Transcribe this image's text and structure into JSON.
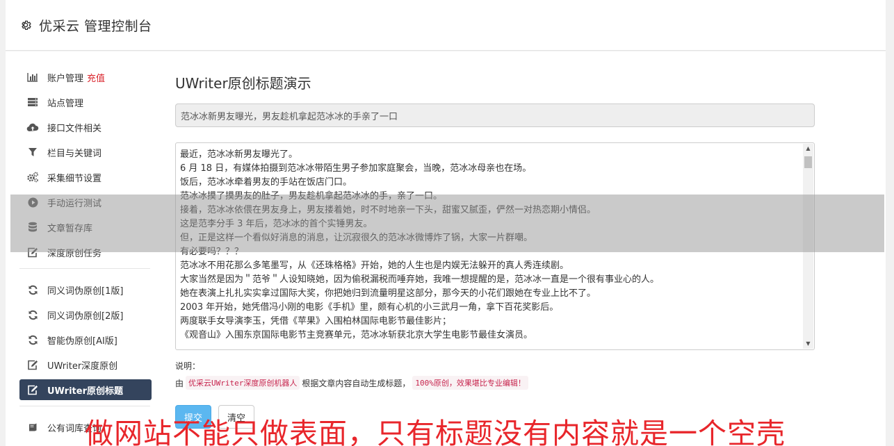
{
  "header": {
    "title": "优采云 管理控制台",
    "icon": "gear-icon"
  },
  "sidebar": {
    "items": [
      {
        "label": "账户管理",
        "accent": "充值",
        "icon": "bar-chart-icon"
      },
      {
        "label": "站点管理",
        "icon": "server-icon"
      },
      {
        "label": "接口文件相关",
        "icon": "cloud-upload-icon"
      },
      {
        "label": "栏目与关键词",
        "icon": "filter-icon"
      },
      {
        "label": "采集细节设置",
        "icon": "cogs-icon"
      },
      {
        "label": "手动运行测试",
        "icon": "play-circle-icon"
      },
      {
        "label": "文章暂存库",
        "icon": "database-icon"
      },
      {
        "label": "深度原创任务",
        "icon": "edit-icon"
      },
      {
        "label": "同义词伪原创[1版]",
        "icon": "refresh-icon"
      },
      {
        "label": "同义词伪原创[2版]",
        "icon": "refresh-icon"
      },
      {
        "label": "智能伪原创[AI版]",
        "icon": "refresh-icon"
      },
      {
        "label": "UWriter深度原创",
        "icon": "edit-icon"
      },
      {
        "label": "UWriter原创标题",
        "icon": "edit-icon",
        "active": true
      },
      {
        "label": "公有词库查询",
        "icon": "book-icon"
      }
    ]
  },
  "main": {
    "heading": "UWriter原创标题演示",
    "title_value": "范冰冰新男友曝光，男友趁机拿起范冰冰的手亲了一口",
    "article": [
      "最近，范冰冰新男友曝光了。",
      "6 月 18 日，有媒体拍摄到范冰冰带陌生男子参加家庭聚会，当晚，范冰冰母亲也在场。",
      "饭后，范冰冰牵着男友的手站在饭店门口。",
      "范冰冰摸了摸男友的肚子，男友趁机拿起范冰冰的手，亲了一口。",
      "接着，范冰冰依偎在男友身上，男友搂着她，时不时地亲一下头，甜蜜又腻歪，俨然一对热恋期小情侣。",
      "这是范李分手 3 年后，范冰冰的首个实锤男友。",
      "但，正是这样一个看似好消息的消息，让沉寂很久的范冰冰微博炸了锅，大家一片群嘲。",
      "有必要吗？？？",
      "范冰冰不用花那么多笔墨写，从《还珠格格》开始，她的人生也是内娱无法躲开的真人秀连续剧。",
      "大家当然是因为＂范爷＂人设知晓她，因为偷税漏税而唾弃她，我唯一想提醒的是，范冰冰一直是一个很有事业心的人。",
      "她在表演上扎扎实实拿过国际大奖，你把她归到流量明星这部分，那今天的小花们跟她在专业上比不了。",
      "2003 年开始，她凭借冯小刚的电影《手机》里，颇有心机的小三武月一角，拿下百花奖影后。",
      "两度联手女导演李玉，凭借《苹果》入围柏林国际电影节最佳影片；",
      "《观音山》入围东京国际电影节主竞赛单元，范冰冰斩获北京大学生电影节最佳女演员。"
    ],
    "note_label": "说明：",
    "note_prefix": "由",
    "note_code1": "优采云UWriter深度原创机器人",
    "note_middle": "根据文章内容自动生成标题，",
    "note_code2": "100%原创，效果堪比专业编辑！",
    "submit_label": "提交",
    "clear_label": "清空"
  },
  "watermark": "做网站不能只做表面，只有标题没有内容就是一个空壳",
  "colors": {
    "accent": "#d9222a",
    "active_nav": "#34445d",
    "primary_button": "#5bb7f0",
    "code_text": "#c7254e"
  }
}
